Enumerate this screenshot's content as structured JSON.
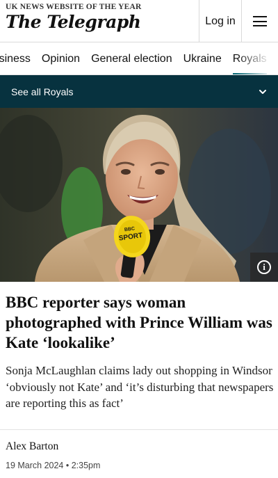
{
  "header": {
    "award": "UK NEWS WEBSITE OF THE YEAR",
    "brand": "The Telegraph",
    "login_label": "Log in"
  },
  "nav": {
    "items": [
      "Business",
      "Opinion",
      "General election",
      "Ukraine",
      "Royals"
    ],
    "active": "Royals"
  },
  "section": {
    "label": "See all Royals"
  },
  "hero": {
    "mic_logo_line1": "BBC",
    "mic_logo_line2": "SPORT",
    "info_icon": "info-icon"
  },
  "article": {
    "headline": "BBC reporter says woman photographed with Prince William was Kate ‘lookalike’",
    "standfirst": "Sonja McLaughlan claims lady out shopping in Windsor ‘obviously not Kate’ and ‘it’s disturbing that newspapers are reporting this as fact’",
    "author": "Alex Barton",
    "date": "19 March 2024",
    "time": "2:35pm"
  },
  "colors": {
    "section_bar": "#07323f",
    "active_underline": "#0a6b78"
  }
}
